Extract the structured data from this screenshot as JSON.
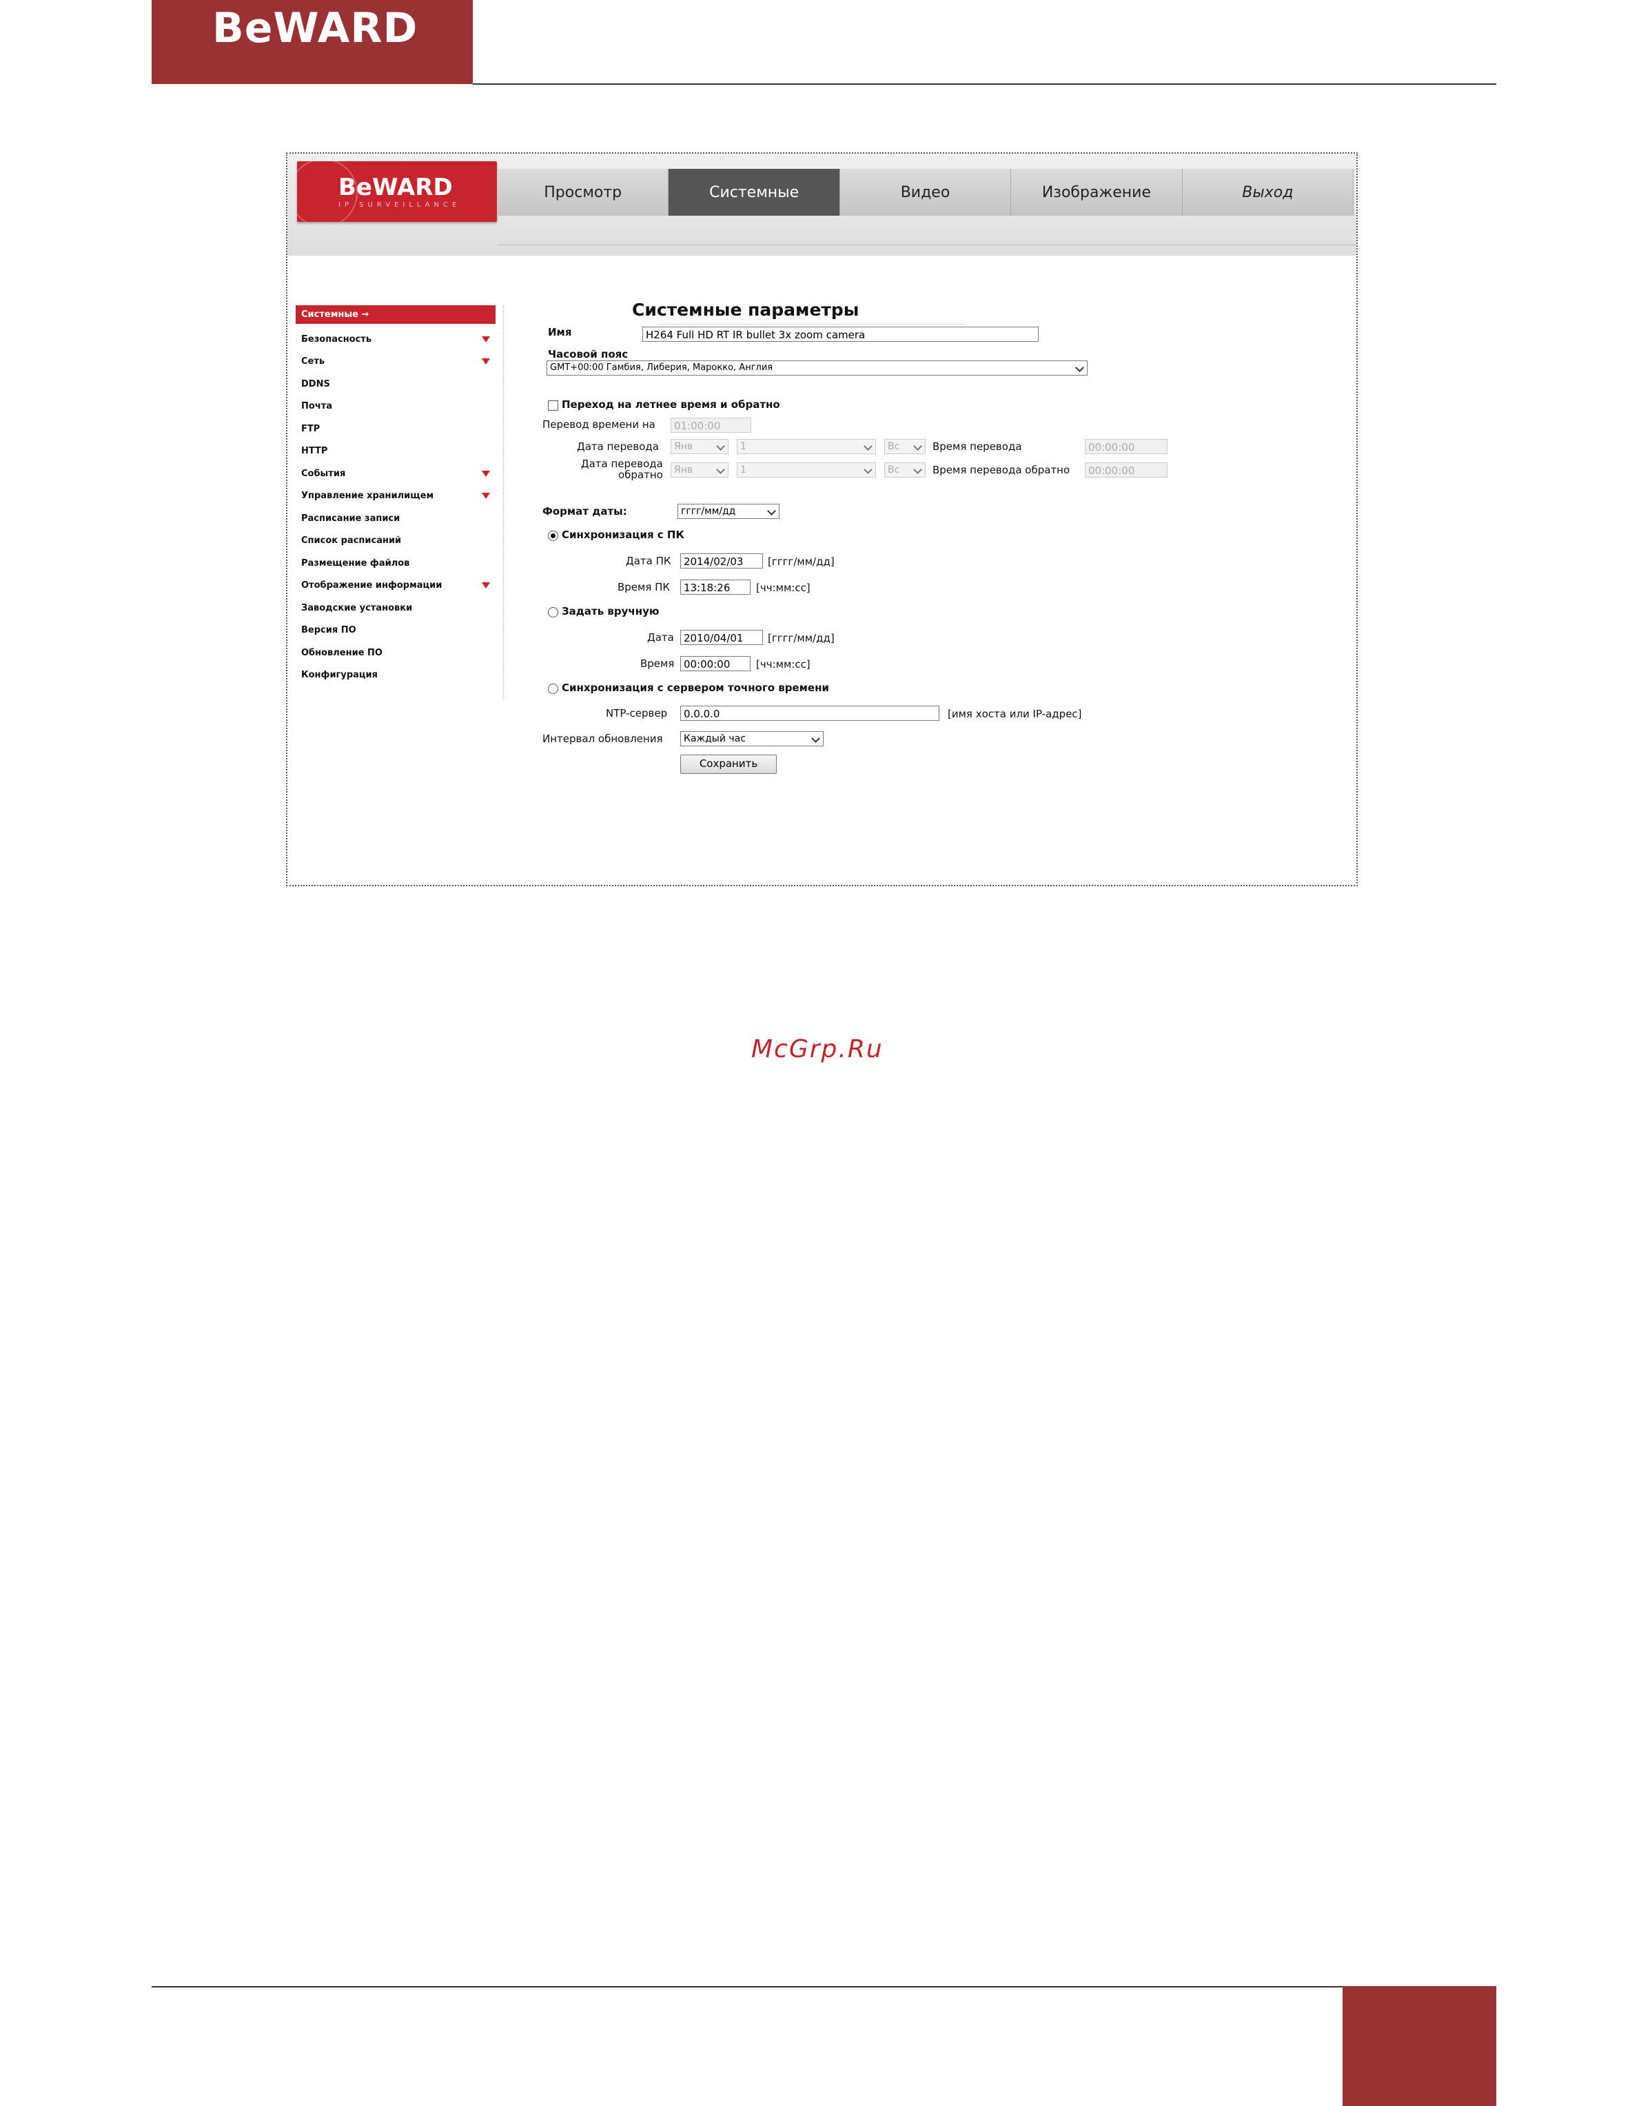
{
  "header": {
    "brand": "BeWARD"
  },
  "screenshot": {
    "logo": {
      "brand": "BeWARD",
      "tagline": "IP SURVEILLANCE"
    },
    "nav_tabs": [
      "Просмотр",
      "Системные",
      "Видео",
      "Изображение",
      "Выход"
    ],
    "sidebar": {
      "items": [
        "Системные",
        "Безопасность",
        "Сеть",
        "DDNS",
        "Почта",
        "FTP",
        "HTTP",
        "События",
        "Управление хранилищем",
        "Расписание записи",
        "Список расписаний",
        "Размещение файлов",
        "Отображение информации",
        "Заводские установки",
        "Версия ПО",
        "Обновление ПО",
        "Конфигурация"
      ],
      "arrow": "→"
    },
    "form": {
      "title": "Системные параметры",
      "name_label": "Имя",
      "name_value": "H264 Full HD RT IR bullet 3x zoom camera",
      "timezone_label": "Часовой пояс",
      "timezone_value": "GMT+00:00 Гамбия, Либерия, Марокко, Англия",
      "dst_label": "Переход на летнее время и обратно",
      "dst_offset_label": "Перевод времени на",
      "dst_offset_value": "01:00:00",
      "dst_start_date_label": "Дата перевода",
      "dst_end_date_label_1": "Дата перевода",
      "dst_end_date_label_2": "обратно",
      "month_value": "Янв",
      "week_value": "1",
      "day_value": "Вс",
      "dst_start_time_label": "Время перевода",
      "dst_end_time_label": "Время перевода обратно",
      "dst_time_value": "00:00:00",
      "date_format_label": "Формат даты:",
      "date_format_value": "гггг/мм/дд",
      "sync_pc_label": "Синхронизация с ПК",
      "pc_date_label": "Дата ПК",
      "pc_date_value": "2014/02/03",
      "pc_time_label": "Время ПК",
      "pc_time_value": "13:18:26",
      "date_hint": "[гггг/мм/дд]",
      "time_hint": "[чч:мм:сс]",
      "manual_label": "Задать вручную",
      "manual_date_label": "Дата",
      "manual_date_value": "2010/04/01",
      "manual_time_label": "Время",
      "manual_time_value": "00:00:00",
      "ntp_sync_label": "Синхронизация с сервером точного времени",
      "ntp_server_label": "NTP-сервер",
      "ntp_server_value": "0.0.0.0",
      "ntp_hint": "[имя хоста или IP-адрес]",
      "interval_label": "Интервал обновления",
      "interval_value": "Каждый час",
      "save_label": "Сохранить"
    }
  },
  "site_watermark": "McGrp.Ru",
  "colors": {
    "brand_red": "#993333",
    "camera_red": "#c8242e",
    "active_tab": "#555555"
  }
}
